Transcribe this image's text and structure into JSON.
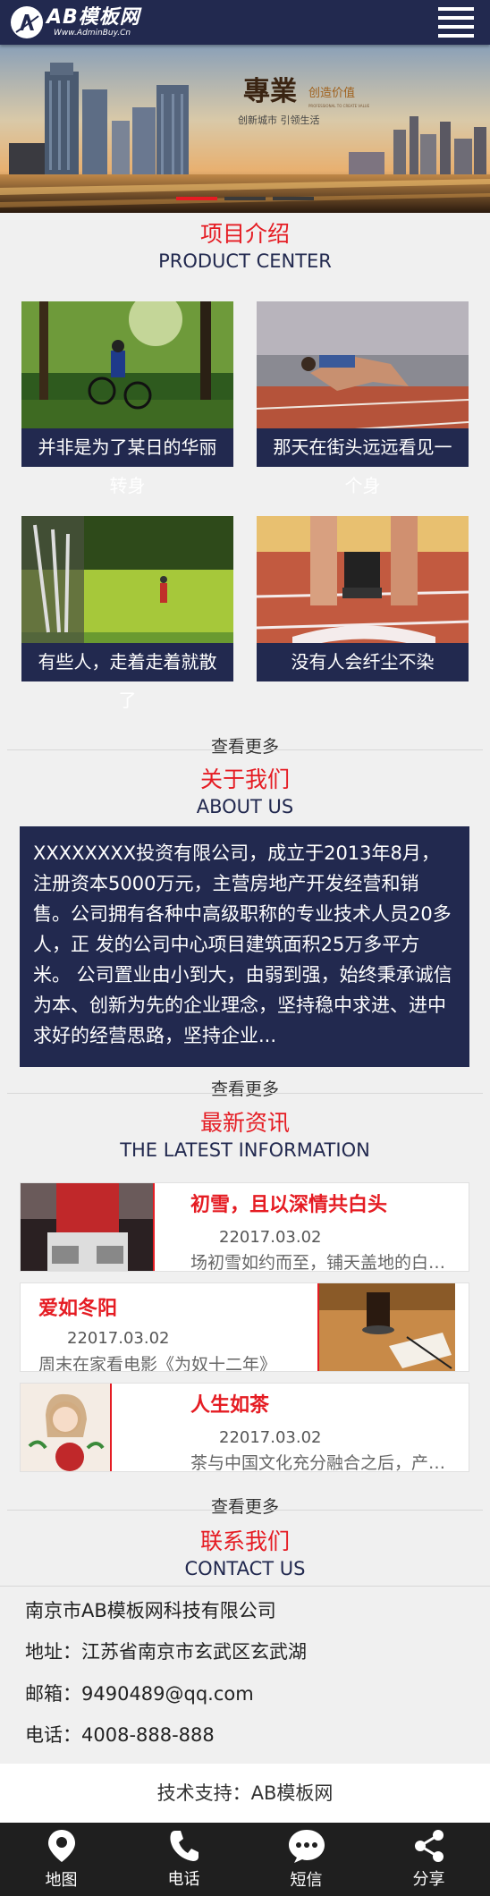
{
  "header": {
    "logo_text": "AB模板网",
    "logo_sub": "Www.AdminBuy.Cn",
    "icons": {
      "logo": "ab-logo-icon",
      "menu": "hamburger-menu-icon"
    }
  },
  "banner": {
    "headline": "專業",
    "tagline": "创造价值",
    "tagline_en": "PROFESSIONAL TO CREATE VALUE",
    "subline": "创新城市  引领生活",
    "slides": 3,
    "active_slide": 1
  },
  "products": {
    "title_cn": "项目介绍",
    "title_en": "PRODUCT CENTER",
    "items": [
      {
        "caption": "并非是为了某日的华丽转身",
        "image": "mountain-biker-forest"
      },
      {
        "caption": "那天在街头远远看见一个身",
        "image": "sprinter-track"
      },
      {
        "caption": "有些人，走着走着就散了",
        "image": "golf-course"
      },
      {
        "caption": "没有人会纤尘不染",
        "image": "runner-start-line"
      }
    ],
    "more": "查看更多"
  },
  "about": {
    "title_cn": "关于我们",
    "title_en": "ABOUT US",
    "text": "XXXXXXXX投资有限公司，成立于2013年8月，注册资本5000万元，主营房地产开发经营和销售。公司拥有各种中高级职称的专业技术人员20多人，正 发的公司中心项目建筑面积25万多平方米。 公司置业由小到大，由弱到强，始终秉承诚信为本、创新为先的企业理念，坚持稳中求进、进中求好的经营思路，坚持企业...",
    "more": "查看更多"
  },
  "news": {
    "title_cn": "最新资讯",
    "title_en": "THE LATEST INFORMATION",
    "items": [
      {
        "title": "初雪，且以深情共白头",
        "date": "22017.03.02",
        "desc": "场初雪如约而至，铺天盖地的白色覆盖",
        "image": "woman-red-scarf-snow"
      },
      {
        "title": "爱如冬阳",
        "date": "22017.03.02",
        "desc": "周末在家看电影《为奴十二年》",
        "image": "coffee-and-notebook"
      },
      {
        "title": "人生如茶",
        "date": "22017.03.02",
        "desc": "茶与中国文化充分融合之后，产生了",
        "image": "girl-illustration"
      }
    ],
    "more": "查看更多"
  },
  "contact": {
    "title_cn": "联系我们",
    "title_en": "CONTACT US",
    "company": "南京市AB模板网科技有限公司",
    "address": "地址：江苏省南京市玄武区玄武湖",
    "email": "邮箱：9490489@qq.com",
    "phone": "电话：4008-888-888"
  },
  "support": "技术支持：AB模板网",
  "footer": {
    "items": [
      {
        "label": "地图",
        "icon": "map-pin-icon"
      },
      {
        "label": "电话",
        "icon": "phone-icon"
      },
      {
        "label": "短信",
        "icon": "sms-chat-icon"
      },
      {
        "label": "分享",
        "icon": "share-icon"
      }
    ]
  },
  "colors": {
    "navy": "#22294f",
    "accent_red": "#e51c23",
    "footer_bg": "#1f1f1f"
  }
}
